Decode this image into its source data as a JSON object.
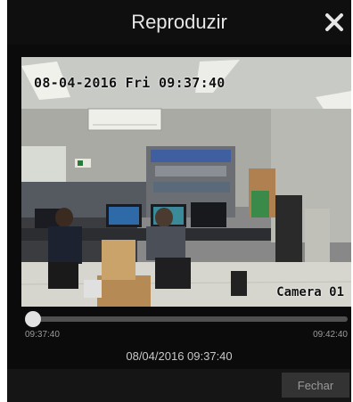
{
  "dialog": {
    "title": "Reproduzir",
    "close_icon": "close-x-icon"
  },
  "video": {
    "osd_timestamp": "08-04-2016 Fri 09:37:40",
    "osd_camera": "Camera 01"
  },
  "playback": {
    "start_time": "09:37:40",
    "end_time": "09:42:40",
    "position_fraction": 0.0,
    "current_datetime": "08/04/2016 09:37:40"
  },
  "footer": {
    "close_label": "Fechar"
  },
  "colors": {
    "background": "#0b0b0b",
    "title_text": "#e6e6e6",
    "track": "#505050",
    "thumb": "#e2e2e2",
    "button_bg": "#333333"
  }
}
